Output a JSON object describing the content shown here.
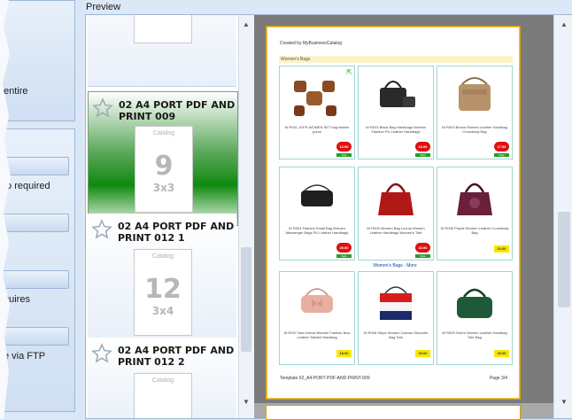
{
  "left_panel": {
    "text_entire": "entire",
    "text_required": "to required",
    "text_requires": "quires",
    "text_ftp": "e via FTP"
  },
  "preview": {
    "title": "Preview",
    "templates": [
      {
        "name": "02 A4 PORT PDF AND PRINT 009",
        "thumb_title": "Catalog",
        "thumb_number": "9",
        "thumb_grid": "3x3",
        "selected": true
      },
      {
        "name": "02 A4 PORT PDF AND PRINT 012 1",
        "thumb_title": "Catalog",
        "thumb_number": "12",
        "thumb_grid": "3x4",
        "selected": false
      },
      {
        "name": "02 A4 PORT PDF AND PRINT 012 2",
        "thumb_title": "Catalog",
        "thumb_number": "",
        "thumb_grid": "",
        "selected": false
      }
    ],
    "page": {
      "header": "Created by MyBusinessCatalog",
      "section1": "Women's Bags",
      "section2": "Women's Bags - More",
      "footer_left": "Template 02_A4-PORT-PDF-AND-PRINT-009",
      "footer_right": "Page 3/4",
      "products": [
        {
          "desc": "W R001 JOFR WOMEN SET bag leather purse",
          "price": "12.00",
          "price_style": "red",
          "tag": "Sale"
        },
        {
          "desc": "W R002 Black Bag Handbags Woman Fashion PU Leather Handbags",
          "price": "16.00",
          "price_style": "red",
          "tag": "Sale"
        },
        {
          "desc": "W R003 Brown Women Leather Handbag Crossbody Bag",
          "price": "17.00",
          "price_style": "red",
          "tag": "Sale"
        },
        {
          "desc": "W R004 Fashion Small Bag Women Messenger Bags PU Leather Handbags",
          "price": "20.00",
          "price_style": "red",
          "tag": "Sale"
        },
        {
          "desc": "W R005 Women Bag Luxury Women Leather Handbags Women's Tote",
          "price": "32.00",
          "price_style": "red",
          "tag": "Sale"
        },
        {
          "desc": "W R006 Purple Women Leather Crossbody Bag",
          "price": "22.00",
          "price_style": "yellow",
          "tag": ""
        },
        {
          "desc": "W R007 New Arrival Women Fashion Bow Leather Satchel Handbag",
          "price": "18.00",
          "price_style": "yellow",
          "tag": ""
        },
        {
          "desc": "W R008 Stripe Women Canvas Shoulder Bag Tote",
          "price": "20.00",
          "price_style": "yellow",
          "tag": ""
        },
        {
          "desc": "W R009 Green Women Leather Handbag Tote Bag",
          "price": "46.00",
          "price_style": "yellow",
          "tag": ""
        }
      ]
    }
  },
  "colors": {
    "selected_gradient": "#0f8a0f",
    "price_red": "#e01010",
    "price_yellow": "#f7e600",
    "page_border": "#d8a200",
    "preview_bg": "#7b7b7b"
  }
}
